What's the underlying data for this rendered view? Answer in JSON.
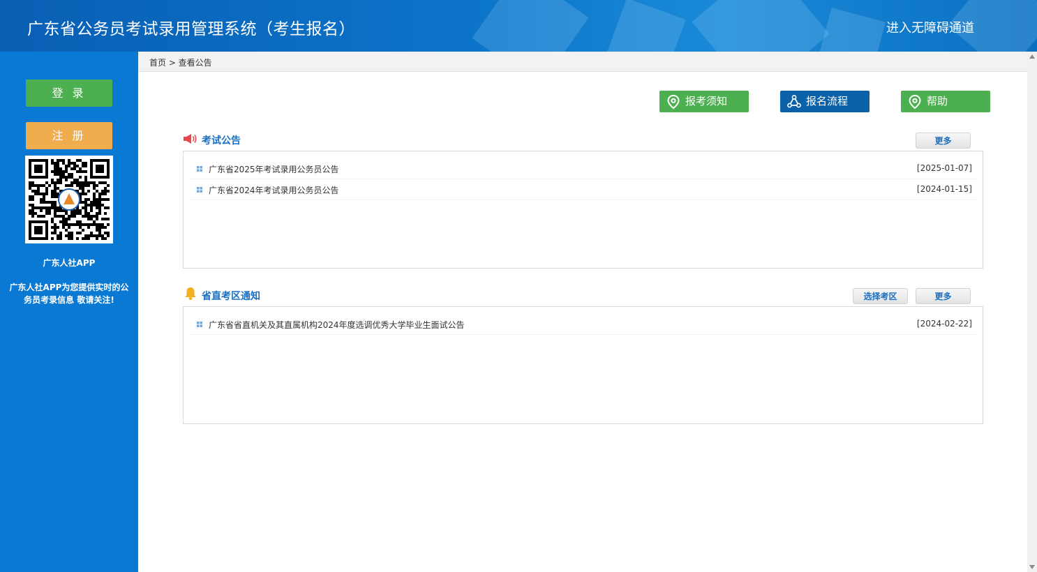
{
  "header": {
    "title": "广东省公务员考试录用管理系统（考生报名）",
    "accessible_link": "进入无障碍通道"
  },
  "sidebar": {
    "login_label": "登 录",
    "register_label": "注 册",
    "app_name": "广东人社APP",
    "app_desc": "广东人社APP为您提供实时的公务员考录信息 敬请关注!"
  },
  "breadcrumb": "首页 > 查看公告",
  "toolbar": {
    "notice_label": "报考须知",
    "flow_label": "报名流程",
    "help_label": "帮助"
  },
  "exam_announcements": {
    "title": "考试公告",
    "more_label": "更多",
    "items": [
      {
        "title": "广东省2025年考试录用公务员公告",
        "date": "[2025-01-07]"
      },
      {
        "title": "广东省2024年考试录用公务员公告",
        "date": "[2024-01-15]"
      }
    ]
  },
  "district_notices": {
    "title": "省直考区通知",
    "select_label": "选择考区",
    "more_label": "更多",
    "items": [
      {
        "title": "广东省省直机关及其直属机构2024年度选调优秀大学毕业生面试公告",
        "date": "[2024-02-22]"
      }
    ]
  },
  "colors": {
    "header_blue": "#0b74c9",
    "sidebar_blue": "#0a79d3",
    "green": "#4caf50",
    "orange": "#f0ad4e",
    "dark_blue": "#0b62a8",
    "link_blue": "#1a6fc1"
  }
}
